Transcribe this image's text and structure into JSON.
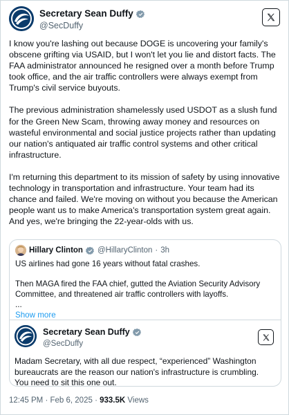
{
  "tweet": {
    "author_name": "Secretary Sean Duffy",
    "author_handle": "@SecDuffy",
    "paragraphs": [
      "I know you're lashing out because DOGE is uncovering your family's obscene grifting via USAID, but I won't let you lie and distort facts. The FAA administrator announced he resigned over a month before Trump took office, and the air traffic controllers were always exempt from Trump's civil service buyouts.",
      "The previous administration shamelessly used USDOT as a slush fund for the Green New Scam, throwing away money and resources on wasteful environmental and social justice projects rather than updating our nation's antiquated air traffic control systems and other critical infrastructure.",
      "I'm returning this department to its mission of safety by using innovative technology in transportation and infrastructure. Your team had its chance and failed. We're moving on without you because the American people want us to make America's transportation system great again. And yes, we're bringing the 22-year-olds with us."
    ],
    "time": "12:45 PM",
    "date": "Feb 6, 2025",
    "separator": "·",
    "views_count": "933.5K",
    "views_label": "Views"
  },
  "quoted": {
    "author_name": "Hillary Clinton",
    "author_handle": "@HillaryClinton",
    "age": "3h",
    "separator": "·",
    "paragraphs": [
      "US airlines had gone 16 years without fatal crashes.",
      "Then MAGA fired the FAA chief, gutted the Aviation Security Advisory Committee, and threatened air traffic controllers with layoffs."
    ],
    "ellipsis": "...",
    "show_more": "Show more"
  },
  "reply": {
    "author_name": "Secretary Sean Duffy",
    "author_handle": "@SecDuffy",
    "text": "Madam Secretary, with all due respect, “experienced” Washington bureaucrats are the reason our nation's infrastructure is crumbling. You need to sit this one out."
  },
  "colors": {
    "accent": "#1d9bf0",
    "verified_badge": "#829aab",
    "secondary_text": "#536471",
    "border": "#cfd9de",
    "dot_logo_blue": "#0b3b6b"
  },
  "icons": [
    "dot-seal-icon",
    "verified-badge-icon",
    "x-logo-icon"
  ]
}
